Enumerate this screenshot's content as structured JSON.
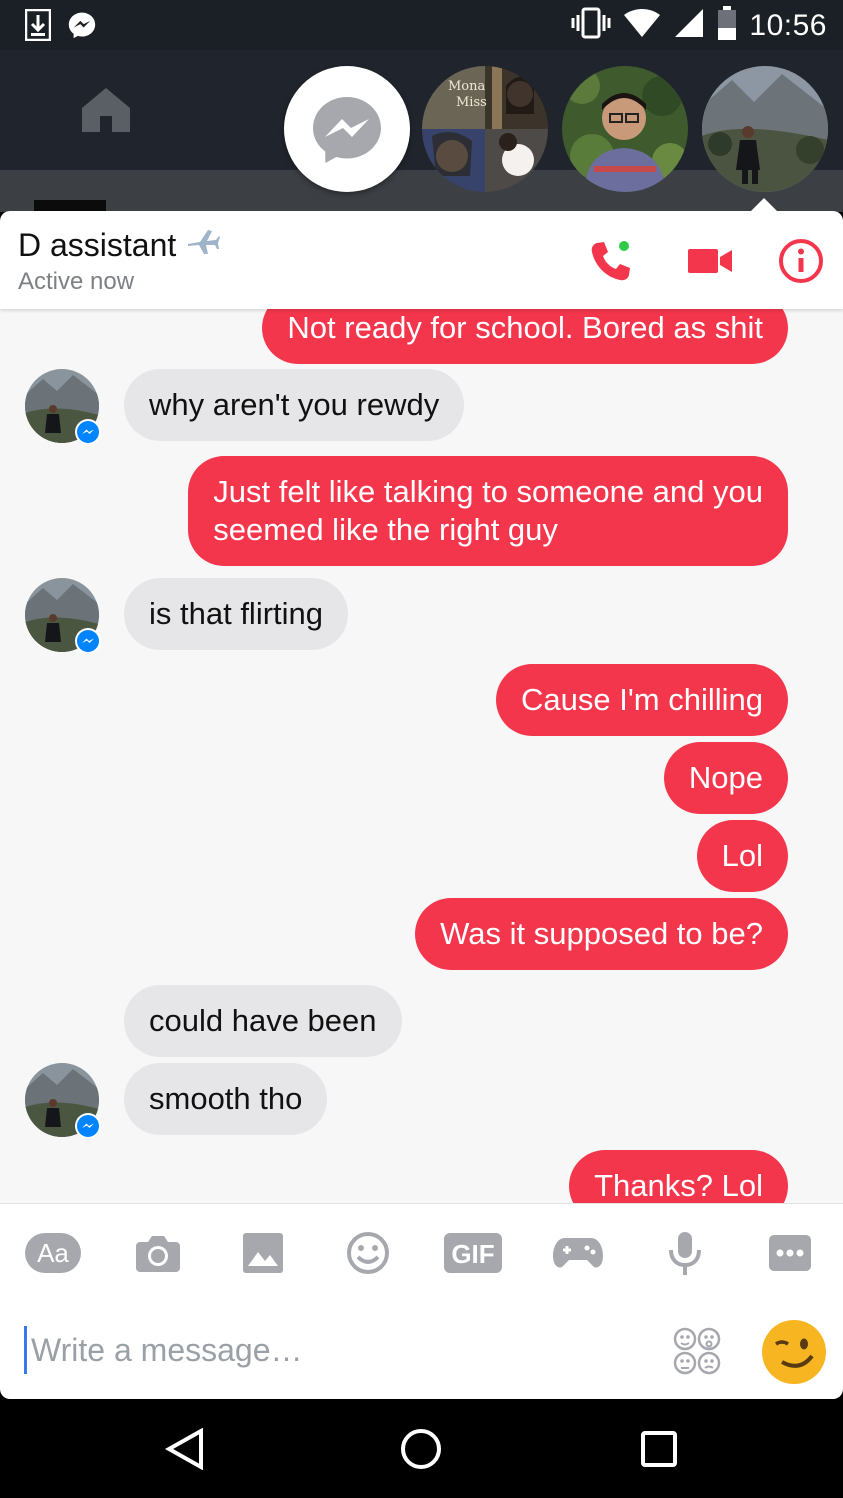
{
  "status_bar": {
    "time": "10:56"
  },
  "chat_heads": {
    "group_photo_text": [
      "Mona",
      "Miss"
    ]
  },
  "conversation": {
    "name": "D assistant",
    "name_emoji": "✈",
    "status": "Active now"
  },
  "messages": [
    {
      "side": "out",
      "text": "Not ready for school. Bored as shit"
    },
    {
      "side": "in",
      "text": "why aren't you rewdy"
    },
    {
      "side": "out",
      "text": "Just felt like talking to someone and you",
      "text2": "seemed like the right guy"
    },
    {
      "side": "in",
      "text": "is that flirting"
    },
    {
      "side": "out",
      "text": "Cause I'm chilling"
    },
    {
      "side": "out",
      "text": "Nope"
    },
    {
      "side": "out",
      "text": "Lol"
    },
    {
      "side": "out",
      "text": "Was it supposed to be?"
    },
    {
      "side": "in",
      "text": "could have been"
    },
    {
      "side": "in",
      "text": "smooth tho"
    },
    {
      "side": "out",
      "text": "Thanks? Lol"
    }
  ],
  "composer": {
    "placeholder": "Write a message…",
    "tools": {
      "text_label": "Aa",
      "gif_label": "GIF"
    }
  },
  "colors": {
    "accent": "#f4364c",
    "incoming_bubble": "#e6e6e8",
    "active_dot": "#31cc46",
    "messenger_blue": "#0084ff"
  },
  "icons": [
    "download-icon",
    "messenger-icon",
    "vibrate-icon",
    "wifi-icon",
    "signal-icon",
    "battery-icon",
    "home-icon",
    "phone-icon",
    "video-icon",
    "info-icon",
    "camera-icon",
    "image-icon",
    "smiley-icon",
    "game-icon",
    "mic-icon",
    "more-icon",
    "sticker-icon",
    "wink-emoji-icon",
    "back-icon",
    "home-circle-icon",
    "recents-icon"
  ]
}
